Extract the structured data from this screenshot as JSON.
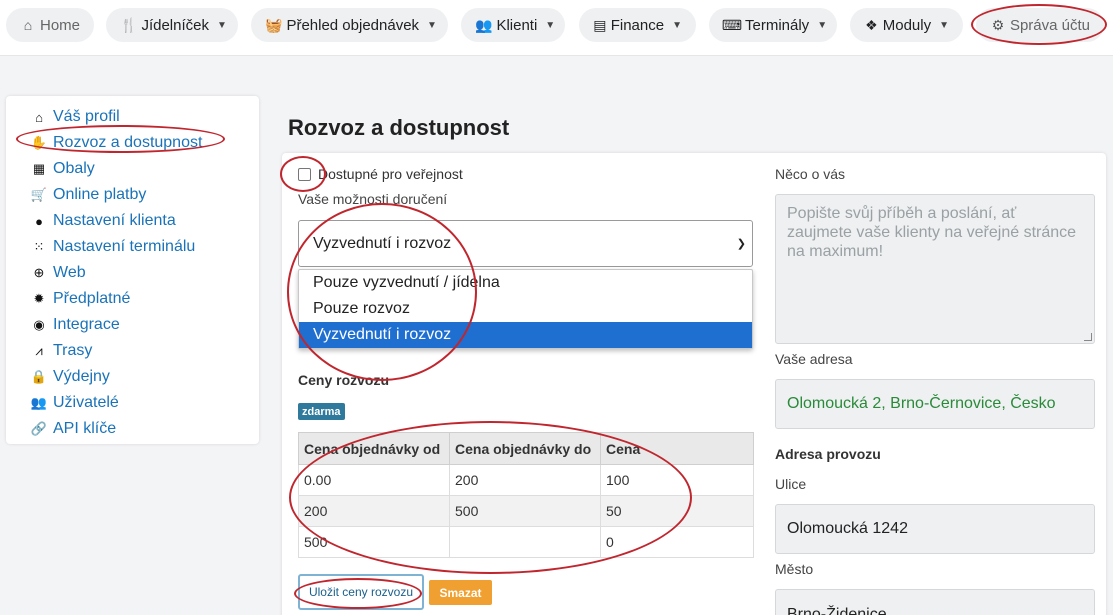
{
  "nav": {
    "items": [
      {
        "label": "Home",
        "icon": "home-icon"
      },
      {
        "label": "Jídelníček",
        "icon": "cutlery-icon"
      },
      {
        "label": "Přehled objednávek",
        "icon": "basket-icon"
      },
      {
        "label": "Klienti",
        "icon": "users-icon"
      },
      {
        "label": "Finance",
        "icon": "cash-register-icon"
      },
      {
        "label": "Terminály",
        "icon": "keyboard-icon"
      },
      {
        "label": "Moduly",
        "icon": "cubes-icon"
      },
      {
        "label": "Správa účtu",
        "icon": "gear-icon"
      }
    ]
  },
  "sidebar": {
    "items": [
      {
        "label": "Váš profil",
        "icon": "home-icon"
      },
      {
        "label": "Rozvoz a dostupnost",
        "icon": "delivery-hand-icon"
      },
      {
        "label": "Obaly",
        "icon": "gift-icon"
      },
      {
        "label": "Online platby",
        "icon": "cart-icon"
      },
      {
        "label": "Nastavení klienta",
        "icon": "user-icon"
      },
      {
        "label": "Nastavení terminálu",
        "icon": "grid-icon"
      },
      {
        "label": "Web",
        "icon": "globe-icon"
      },
      {
        "label": "Předplatné",
        "icon": "certificate-icon"
      },
      {
        "label": "Integrace",
        "icon": "globe-africa-icon"
      },
      {
        "label": "Trasy",
        "icon": "road-icon"
      },
      {
        "label": "Výdejny",
        "icon": "lock-icon"
      },
      {
        "label": "Uživatelé",
        "icon": "users-icon"
      },
      {
        "label": "API klíče",
        "icon": "link-icon"
      }
    ]
  },
  "page": {
    "title": "Rozvoz a dostupnost"
  },
  "form": {
    "public_checkbox_label": "Dostupné pro veřejnost",
    "public_checked": false,
    "delivery_label": "Vaše možnosti doručení",
    "delivery_selected": "Vyzvednutí i rozvoz",
    "delivery_options": [
      "Pouze vyzvednutí / jídelna",
      "Pouze rozvoz",
      "Vyzvednutí i rozvoz"
    ],
    "prices_title": "Ceny rozvozu",
    "free_badge": "zdarma",
    "table": {
      "headers": [
        "Cena objednávky od",
        "Cena objednávky do",
        "Cena"
      ],
      "rows": [
        [
          "0.00",
          "200",
          "100"
        ],
        [
          "200",
          "500",
          "50"
        ],
        [
          "500",
          "",
          "0"
        ]
      ]
    },
    "save_label": "Uložit ceny rozvozu",
    "delete_label": "Smazat"
  },
  "right": {
    "about_label": "Něco o vás",
    "about_placeholder": "Popište svůj příběh a poslání, ať zaujmete vaše klienty na veřejné stránce na maximum!",
    "address_label": "Vaše adresa",
    "address_value": "Olomoucká 2, Brno-Černovice, Česko",
    "operation_title": "Adresa provozu",
    "street_label": "Ulice",
    "street_value": "Olomoucká 1242",
    "city_label": "Město",
    "city_value": "Brno-Židenice"
  },
  "colors": {
    "link": "#1a73b8",
    "selected_option": "#1f6fd1",
    "badge": "#2f7a9c",
    "delete_button": "#f0a030",
    "annotation": "#c0262e",
    "address_text": "#2a8a3a"
  }
}
